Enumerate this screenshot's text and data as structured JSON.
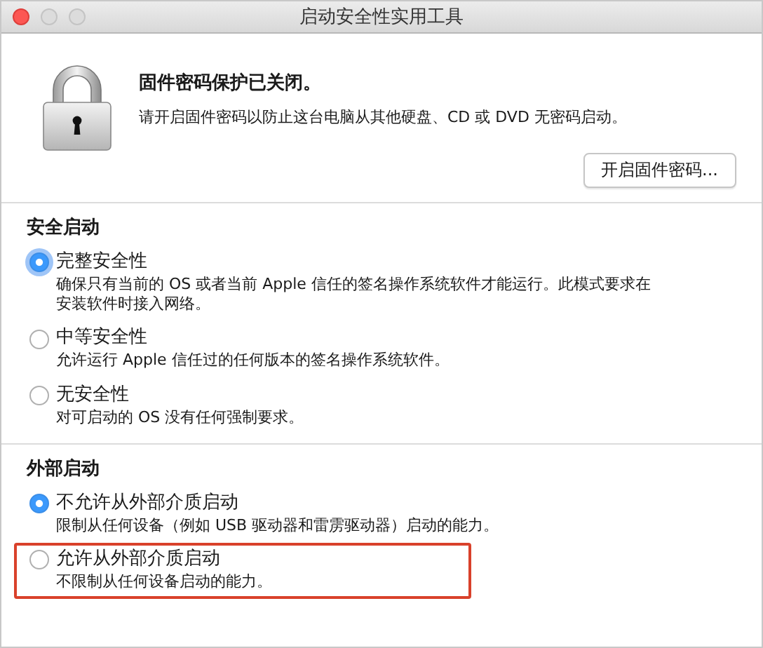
{
  "window": {
    "title": "启动安全性实用工具"
  },
  "firmware": {
    "title": "固件密码保护已关闭。",
    "description": "请开启固件密码以防止这台电脑从其他硬盘、CD 或 DVD 无密码启动。",
    "button": "开启固件密码..."
  },
  "sections": [
    {
      "title": "安全启动",
      "options": [
        {
          "label": "完整安全性",
          "description": "确保只有当前的 OS 或者当前 Apple 信任的签名操作系统软件才能运行。此模式要求在安装软件时接入网络。",
          "selected": true,
          "focused": true,
          "highlighted": false
        },
        {
          "label": "中等安全性",
          "description": "允许运行 Apple 信任过的任何版本的签名操作系统软件。",
          "selected": false,
          "focused": false,
          "highlighted": false
        },
        {
          "label": "无安全性",
          "description": "对可启动的 OS 没有任何强制要求。",
          "selected": false,
          "focused": false,
          "highlighted": false
        }
      ]
    },
    {
      "title": "外部启动",
      "options": [
        {
          "label": "不允许从外部介质启动",
          "description": "限制从任何设备（例如 USB 驱动器和雷雳驱动器）启动的能力。",
          "selected": true,
          "focused": false,
          "highlighted": false
        },
        {
          "label": "允许从外部介质启动",
          "description": "不限制从任何设备启动的能力。",
          "selected": false,
          "focused": false,
          "highlighted": true
        }
      ]
    }
  ]
}
